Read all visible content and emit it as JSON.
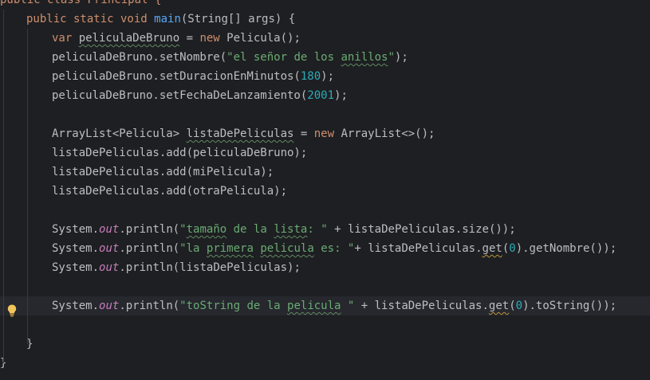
{
  "editor": {
    "lines": [
      {
        "indent": 0,
        "tokens": [
          {
            "t": "public class Principal {",
            "c": "kw-mixed"
          }
        ]
      },
      {
        "indent": 1,
        "tokens": [
          {
            "t": "public static void ",
            "c": "kw"
          },
          {
            "t": "main",
            "c": "fn"
          },
          {
            "t": "(String[] args) {",
            "c": ""
          }
        ]
      },
      {
        "indent": 2,
        "tokens": [
          {
            "t": "var ",
            "c": "kw"
          },
          {
            "t": "peliculaDeBruno",
            "c": "wavy"
          },
          {
            "t": " = ",
            "c": ""
          },
          {
            "t": "new ",
            "c": "kw"
          },
          {
            "t": "Pelicula();",
            "c": ""
          }
        ]
      },
      {
        "indent": 2,
        "tokens": [
          {
            "t": "peliculaDeBruno.setNombre(",
            "c": ""
          },
          {
            "t": "\"el señor de los ",
            "c": "str"
          },
          {
            "t": "anillos",
            "c": "str wavy"
          },
          {
            "t": "\"",
            "c": "str"
          },
          {
            "t": ");",
            "c": ""
          }
        ]
      },
      {
        "indent": 2,
        "tokens": [
          {
            "t": "peliculaDeBruno.setDuracionEnMinutos(",
            "c": ""
          },
          {
            "t": "180",
            "c": "num"
          },
          {
            "t": ");",
            "c": ""
          }
        ]
      },
      {
        "indent": 2,
        "tokens": [
          {
            "t": "peliculaDeBruno.setFechaDeLanzamiento(",
            "c": ""
          },
          {
            "t": "2001",
            "c": "num"
          },
          {
            "t": ");",
            "c": ""
          }
        ]
      },
      {
        "indent": 2,
        "tokens": []
      },
      {
        "indent": 2,
        "tokens": [
          {
            "t": "ArrayList<Pelicula> ",
            "c": ""
          },
          {
            "t": "listaDePeliculas",
            "c": "wavy"
          },
          {
            "t": " = ",
            "c": ""
          },
          {
            "t": "new ",
            "c": "kw"
          },
          {
            "t": "ArrayList<>();",
            "c": ""
          }
        ]
      },
      {
        "indent": 2,
        "tokens": [
          {
            "t": "listaDePeliculas.add(peliculaDeBruno);",
            "c": ""
          }
        ]
      },
      {
        "indent": 2,
        "tokens": [
          {
            "t": "listaDePeliculas.add(miPelicula);",
            "c": ""
          }
        ]
      },
      {
        "indent": 2,
        "tokens": [
          {
            "t": "listaDePeliculas.add(otraPelicula);",
            "c": ""
          }
        ]
      },
      {
        "indent": 2,
        "tokens": []
      },
      {
        "indent": 2,
        "tokens": [
          {
            "t": "System.",
            "c": ""
          },
          {
            "t": "out",
            "c": "fld"
          },
          {
            "t": ".println(",
            "c": ""
          },
          {
            "t": "\"",
            "c": "str"
          },
          {
            "t": "tamaño",
            "c": "str wavy"
          },
          {
            "t": " de la ",
            "c": "str"
          },
          {
            "t": "lista",
            "c": "str wavy"
          },
          {
            "t": ": \"",
            "c": "str"
          },
          {
            "t": " + listaDePeliculas.size());",
            "c": ""
          }
        ]
      },
      {
        "indent": 2,
        "tokens": [
          {
            "t": "System.",
            "c": ""
          },
          {
            "t": "out",
            "c": "fld"
          },
          {
            "t": ".println(",
            "c": ""
          },
          {
            "t": "\"la ",
            "c": "str"
          },
          {
            "t": "primera",
            "c": "str wavy"
          },
          {
            "t": " ",
            "c": "str"
          },
          {
            "t": "pelicula",
            "c": "str wavy"
          },
          {
            "t": " es: \"",
            "c": "str"
          },
          {
            "t": "+ listaDePeliculas.",
            "c": ""
          },
          {
            "t": "get",
            "c": "wavy-warn"
          },
          {
            "t": "(",
            "c": ""
          },
          {
            "t": "0",
            "c": "num"
          },
          {
            "t": ").getNombre());",
            "c": ""
          }
        ]
      },
      {
        "indent": 2,
        "tokens": [
          {
            "t": "System.",
            "c": ""
          },
          {
            "t": "out",
            "c": "fld"
          },
          {
            "t": ".println(listaDePeliculas);",
            "c": ""
          }
        ]
      },
      {
        "indent": 2,
        "tokens": []
      },
      {
        "indent": 2,
        "current": true,
        "tokens": [
          {
            "t": "System.",
            "c": ""
          },
          {
            "t": "out",
            "c": "fld"
          },
          {
            "t": ".println(",
            "c": ""
          },
          {
            "t": "\"toString de la ",
            "c": "str"
          },
          {
            "t": "pelicula",
            "c": "str wavy"
          },
          {
            "t": " \"",
            "c": "str"
          },
          {
            "t": " + listaDePeliculas.",
            "c": ""
          },
          {
            "t": "get",
            "c": "wavy-warn"
          },
          {
            "t": "(",
            "c": ""
          },
          {
            "t": "0",
            "c": "num"
          },
          {
            "t": ").toString());",
            "c": ""
          }
        ]
      },
      {
        "indent": 2,
        "tokens": []
      },
      {
        "indent": 1,
        "tokens": [
          {
            "t": "}",
            "c": ""
          }
        ]
      },
      {
        "indent": 0,
        "tokens": [
          {
            "t": "}",
            "c": ""
          }
        ]
      }
    ],
    "gutter_icon": "lightbulb-icon"
  }
}
